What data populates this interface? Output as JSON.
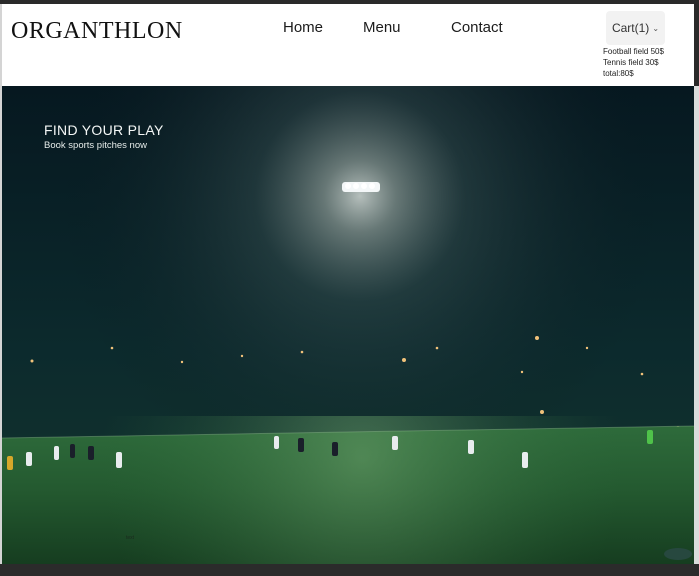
{
  "header": {
    "logo": "ORGANTHLON",
    "nav": {
      "home": "Home",
      "menu": "Menu",
      "contact": "Contact"
    },
    "cart": {
      "label": "Cart(1)",
      "items": [
        "Football field 50$",
        "Tennis field 30$"
      ],
      "total": "total:80$"
    }
  },
  "hero": {
    "title": "FIND YOUR PLAY",
    "subtitle": "Book sports pitches now",
    "caption": "text"
  },
  "colors": {
    "accent": "#f2b21b",
    "hero_bg": "#07161c",
    "pitch": "#2f6a3a"
  },
  "icons": {
    "cart_chevron": "chevron-down-icon"
  }
}
